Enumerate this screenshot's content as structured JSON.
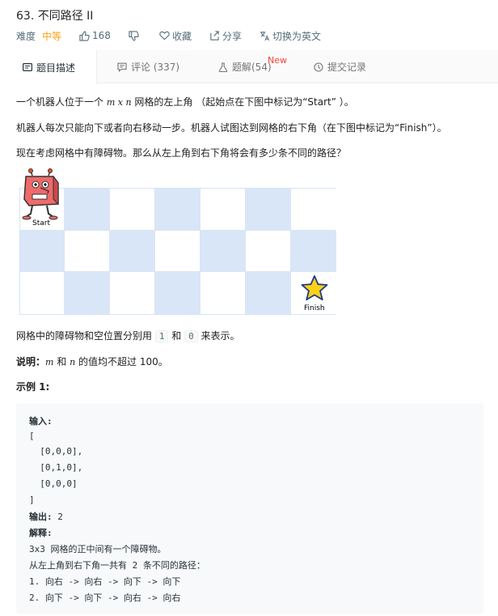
{
  "problem": {
    "title": "63. 不同路径 II"
  },
  "meta": {
    "difficulty_label": "难度",
    "difficulty_value": "中等",
    "likes": "168",
    "favorite": "收藏",
    "share": "分享",
    "translate": "切换为英文"
  },
  "tabs": [
    {
      "label": "题目描述",
      "icon": "document-icon"
    },
    {
      "label": "评论 (337)",
      "icon": "comment-icon"
    },
    {
      "label": "题解(54)",
      "icon": "flask-icon",
      "badge": "New"
    },
    {
      "label": "提交记录",
      "icon": "clock-icon"
    }
  ],
  "description": {
    "p1_a": "一个机器人位于一个 ",
    "p1_m": "m",
    "p1_x": " x ",
    "p1_n": "n",
    "p1_b": " 网格的左上角 （起始点在下图中标记为“Start” ）。",
    "p2": "机器人每次只能向下或者向右移动一步。机器人试图达到网格的右下角（在下图中标记为“Finish”）。",
    "p3": "现在考虑网格中有障碍物。那么从左上角到右下角将会有多少条不同的路径？",
    "figure_start": "Start",
    "figure_finish": "Finish",
    "p4_a": "网格中的障碍物和空位置分别用 ",
    "p4_one": "1",
    "p4_and": " 和 ",
    "p4_zero": "0",
    "p4_b": " 来表示。",
    "note_label": "说明：",
    "note_m": "m",
    "note_and": " 和 ",
    "note_n": "n",
    "note_rest": " 的值均不超过 100。",
    "example_heading": "示例 1:"
  },
  "example": {
    "input_label": "输入:",
    "lines": [
      "[",
      "  [0,0,0],",
      "  [0,1,0],",
      "  [0,0,0]",
      "]"
    ],
    "output_label": "输出:",
    "output_value": " 2",
    "explain_label": "解释:",
    "explain_lines": [
      "3x3 网格的正中间有一个障碍物。",
      "从左上角到右下角一共有 2 条不同的路径：",
      "1. 向右 -> 向右 -> 向下 -> 向下",
      "2. 向下 -> 向下 -> 向右 -> 向右"
    ]
  },
  "colors": {
    "accent_orange": "#ffa116",
    "new_badge": "#f44336",
    "grid_blue": "#d9e6f8"
  }
}
